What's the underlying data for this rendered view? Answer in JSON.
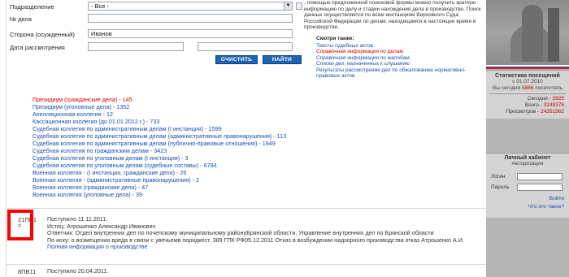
{
  "form": {
    "subdivision_label": "Подразделение",
    "subdivision_value": "- Все -",
    "case_number_label": "№ дела",
    "case_number_value": "",
    "party_label": "Сторона (осужденный)",
    "party_value": "Иванов",
    "date_label": "Дата рассмотрения",
    "date_from": "",
    "date_to": "",
    "clear_button": "ОЧИСТИТЬ",
    "find_button": "НАЙТИ"
  },
  "info_text": ", помощью предложенной поисковой формы можно получить краткую информацию по делу и стадии нахождения дела в производстве. Поиск данных осуществляется по всем инстанциям Верховного Суда Российской Федерации по делам, находящимся в настоящее время в производстве.",
  "see_also": {
    "heading": "Смотри также:",
    "links": [
      "Тексты судебных актов",
      "Справочная информация по делам",
      "Справочная информация по жалобам",
      "Списки дел, назначенных к слушанию",
      "Результаты рассмотрения дел по обжалованию нормативно-правовых актов"
    ],
    "active_index": 1
  },
  "courts": {
    "items": [
      "Президиум (гражданские дела) - 145",
      "Президиум (уголовные дела) - 1352",
      "Апелляционная коллегия - 12",
      "Кассационная коллегия (до 01.01.2012 г.) - 733",
      "Судебная коллегия по административным делам (I инстанция) - 1599",
      "Судебная коллегия по административным делам (административные правонарушения) - 113",
      "Судебная коллегия по административным делам (публично-правовые отношения) - 1949",
      "Судебная коллегия по гражданским делам - 3423",
      "Судебная коллегия по уголовным делам (I инстанция) - 3",
      "Судебная коллегия по уголовным делам (судебные составы) - 6784",
      "Военная коллегия - (I инстанция, гражданские дела) - 26",
      "Военная коллегия - (административные правонарушения) - 2",
      "Военная коллегия (гражданские дела) - 47",
      "Военная коллегия (уголовные дела) - 39"
    ],
    "active_index": 0
  },
  "cases": [
    {
      "number": "21ПВ1",
      "sub": "#",
      "received": "Поступило 11.11.2011.",
      "plaintiff": "Истец: Атрошенко Александр Иванович",
      "defendant": "Ответчик: Отдел внутренних дел по почепскому муниципальному районуБрянской области, Управление внутренних дел по Брянской области",
      "claim": "По иску: о возмещении вреда в связи с увечьемв порядкест. 389 ГПК РФ05.12.2011 Отказ в возбуждении надзорного производства отказ Атрошенко А.И.",
      "link": "Полная информация о производстве"
    },
    {
      "number": "8ПВ11",
      "received": "Поступило 20.04.2011."
    }
  ],
  "sidebar": {
    "stats_title": "Статистика посещений",
    "stats_since": "с 01.07.2010",
    "today_label": "Вы сегодня",
    "today_value": "5886",
    "today_suffix": "посетитель",
    "today_total_label": "Сегодня -",
    "today_total_value": "5925",
    "all_label": "Всего -",
    "all_value": "3249378",
    "views_label": "Просмотров -",
    "views_value": "24351562",
    "cabinet_title": "Личный кабинет",
    "cabinet_sub": "Авторизация",
    "login_label": "Логин",
    "password_label": "Пароль",
    "login_link": "Войти",
    "what_link": "Что это такое?"
  },
  "colors": {
    "link": "#1a4fb0",
    "active_link": "#d40000",
    "button": "#1f63b5",
    "highlight_box": "#ff0000",
    "sidebar_bg": "#b5b5b5",
    "flag": [
      "#ffffff",
      "#1c3fa8",
      "#d21f1f"
    ]
  }
}
